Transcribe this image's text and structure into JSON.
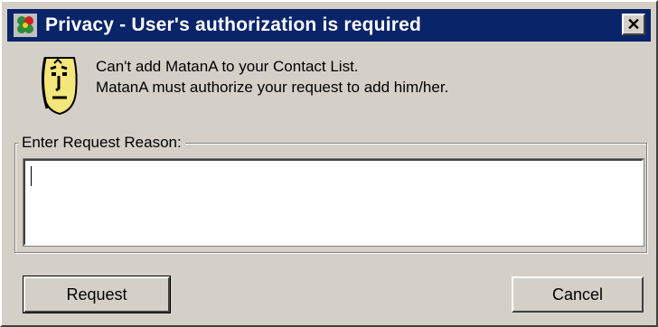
{
  "window": {
    "title": "Privacy - User's authorization is required",
    "close_label": "✕"
  },
  "message": {
    "line1": "Can't add MatanA to your Contact List.",
    "line2": "MatanA must authorize your request to add him/her."
  },
  "reason_group": {
    "label": "Enter Request Reason:",
    "value": ""
  },
  "buttons": {
    "request_label": "Request",
    "cancel_label": "Cancel"
  },
  "colors": {
    "titlebar": "#0a246a",
    "dialog_bg": "#d4d0c8"
  },
  "icons": {
    "title_icon": "icq-flower-icon",
    "message_icon": "privacy-face-icon"
  }
}
